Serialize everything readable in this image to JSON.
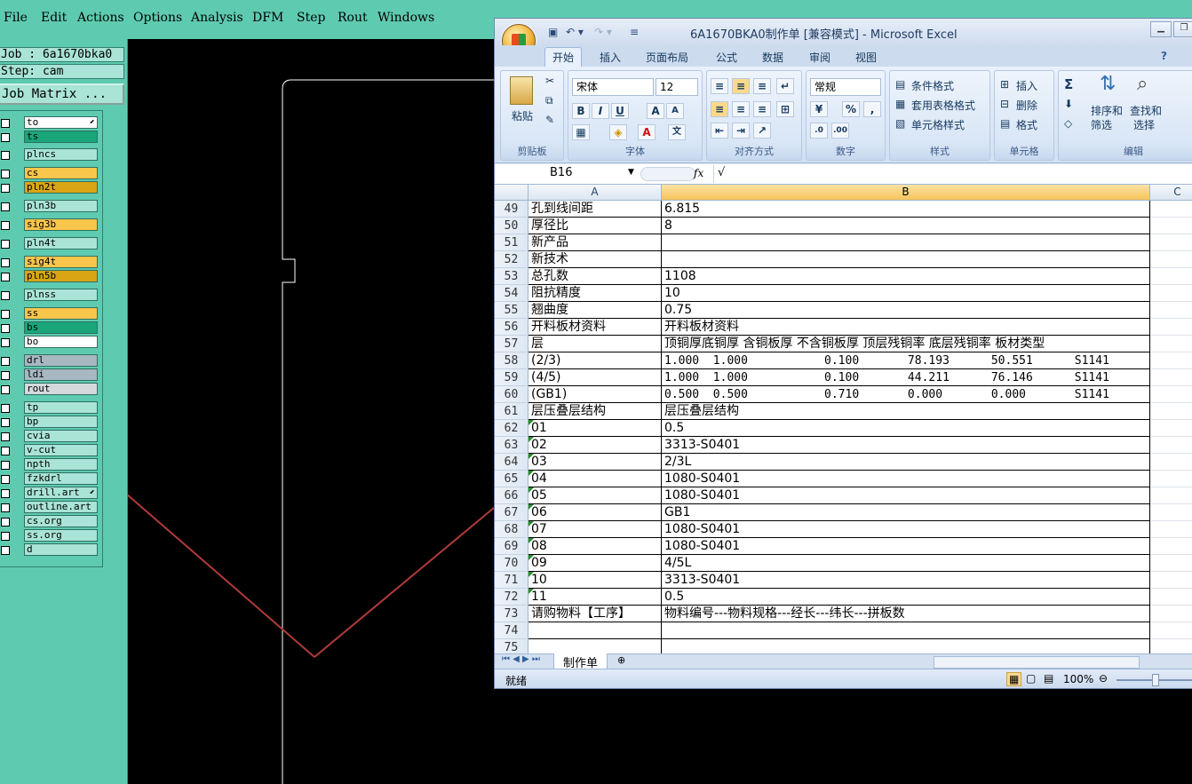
{
  "menubar": {
    "items": [
      "File",
      "Edit",
      "Actions",
      "Options",
      "Analysis",
      "DFM",
      "Step",
      "Rout",
      "Windows"
    ]
  },
  "leftpanel": {
    "job": "Job : 6a1670bka0",
    "step": "Step: cam",
    "matrix_button": "Job Matrix ...",
    "layers": [
      {
        "name": "to",
        "color": "#ffffff",
        "arrow": true
      },
      {
        "name": "ts",
        "color": "#1aa67a",
        "arrow": false
      },
      {
        "name": "plncs",
        "color": "#a9e4d6",
        "arrow": false
      },
      {
        "name": "cs",
        "color": "#f7c64a",
        "arrow": false
      },
      {
        "name": "pln2t",
        "color": "#d9a514",
        "arrow": false
      },
      {
        "name": "pln3b",
        "color": "#a9e4d6",
        "arrow": false
      },
      {
        "name": "sig3b",
        "color": "#f7c64a",
        "arrow": false
      },
      {
        "name": "pln4t",
        "color": "#a9e4d6",
        "arrow": false
      },
      {
        "name": "sig4t",
        "color": "#f7c64a",
        "arrow": false
      },
      {
        "name": "pln5b",
        "color": "#d9a514",
        "arrow": false
      },
      {
        "name": "plnss",
        "color": "#a9e4d6",
        "arrow": false
      },
      {
        "name": "ss",
        "color": "#f7c64a",
        "arrow": false
      },
      {
        "name": "bs",
        "color": "#1aa67a",
        "arrow": false
      },
      {
        "name": "bo",
        "color": "#ffffff",
        "arrow": false
      },
      {
        "name": "drl",
        "color": "#a7b8c2",
        "arrow": false
      },
      {
        "name": "ldi",
        "color": "#a7b8c2",
        "arrow": false
      },
      {
        "name": "rout",
        "color": "#d5d9dc",
        "arrow": false
      },
      {
        "name": "tp",
        "color": "#a9e4d6",
        "arrow": false
      },
      {
        "name": "bp",
        "color": "#a9e4d6",
        "arrow": false
      },
      {
        "name": "cvia",
        "color": "#a9e4d6",
        "arrow": false
      },
      {
        "name": "v-cut",
        "color": "#a9e4d6",
        "arrow": false
      },
      {
        "name": "npth",
        "color": "#a9e4d6",
        "arrow": false
      },
      {
        "name": "fzkdrl",
        "color": "#a9e4d6",
        "arrow": false
      },
      {
        "name": "drill.art",
        "color": "#a9e4d6",
        "arrow": true
      },
      {
        "name": "outline.art",
        "color": "#a9e4d6",
        "arrow": false
      },
      {
        "name": "cs.org",
        "color": "#a9e4d6",
        "arrow": false
      },
      {
        "name": "ss.org",
        "color": "#a9e4d6",
        "arrow": false
      },
      {
        "name": "d",
        "color": "#a9e4d6",
        "arrow": false
      }
    ]
  },
  "excel": {
    "title": "6A1670BKA0制作单  [兼容模式] - Microsoft Excel",
    "tabs": [
      "开始",
      "插入",
      "页面布局",
      "公式",
      "数据",
      "审阅",
      "视图"
    ],
    "groups": [
      "剪贴板",
      "字体",
      "对齐方式",
      "数字",
      "样式",
      "单元格",
      "编辑"
    ],
    "paste_label": "粘贴",
    "font_name": "宋体",
    "font_size": "12",
    "number_format": "常规",
    "style_buttons": [
      "条件格式",
      "套用表格格式",
      "单元格样式"
    ],
    "cell_buttons": [
      "插入",
      "删除",
      "格式"
    ],
    "edit_buttons": [
      "排序和",
      "筛选",
      "查找和",
      "选择"
    ],
    "name_box": "B16",
    "fx": "fx",
    "formula": "√",
    "columns": [
      "A",
      "B",
      "C"
    ],
    "rows": [
      {
        "n": "49",
        "a": "孔到线间距",
        "b": "6.815"
      },
      {
        "n": "50",
        "a": "厚径比",
        "b": "8"
      },
      {
        "n": "51",
        "a": "新产品",
        "b": ""
      },
      {
        "n": "52",
        "a": "新技术",
        "b": ""
      },
      {
        "n": "53",
        "a": "总孔数",
        "b": "1108"
      },
      {
        "n": "54",
        "a": "阻抗精度",
        "b": "10"
      },
      {
        "n": "55",
        "a": "翘曲度",
        "b": "0.75"
      },
      {
        "n": "56",
        "a": "开料板材资料",
        "b": "开料板材资料"
      },
      {
        "n": "57",
        "a": "层",
        "b": "顶铜厚底铜厚 含铜板厚 不含铜板厚 顶层残铜率 底层残铜率 板材类型"
      },
      {
        "n": "58",
        "a": "(2/3)",
        "b": "1.000  1.000           0.100       78.193      50.551      S1141"
      },
      {
        "n": "59",
        "a": "(4/5)",
        "b": "1.000  1.000           0.100       44.211      76.146      S1141"
      },
      {
        "n": "60",
        "a": "(GB1)",
        "b": "0.500  0.500           0.710       0.000       0.000       S1141"
      },
      {
        "n": "61",
        "a": "层压叠层结构",
        "b": "层压叠层结构"
      },
      {
        "n": "62",
        "a": "01",
        "b": "0.5"
      },
      {
        "n": "63",
        "a": "02",
        "b": "3313-S0401"
      },
      {
        "n": "64",
        "a": "03",
        "b": "2/3L"
      },
      {
        "n": "65",
        "a": "04",
        "b": "1080-S0401"
      },
      {
        "n": "66",
        "a": "05",
        "b": "1080-S0401"
      },
      {
        "n": "67",
        "a": "06",
        "b": "GB1"
      },
      {
        "n": "68",
        "a": "07",
        "b": "1080-S0401"
      },
      {
        "n": "69",
        "a": "08",
        "b": "1080-S0401"
      },
      {
        "n": "70",
        "a": "09",
        "b": "4/5L"
      },
      {
        "n": "71",
        "a": "10",
        "b": "3313-S0401"
      },
      {
        "n": "72",
        "a": "11",
        "b": "0.5"
      },
      {
        "n": "73",
        "a": "请购物料【工序】",
        "b": "物料编号---物料规格---经长---纬长---拼板数"
      },
      {
        "n": "74",
        "a": "",
        "b": ""
      },
      {
        "n": "75",
        "a": "",
        "b": ""
      }
    ],
    "sheet_tab": "制作单",
    "status": "就绪",
    "zoom": "100%"
  }
}
